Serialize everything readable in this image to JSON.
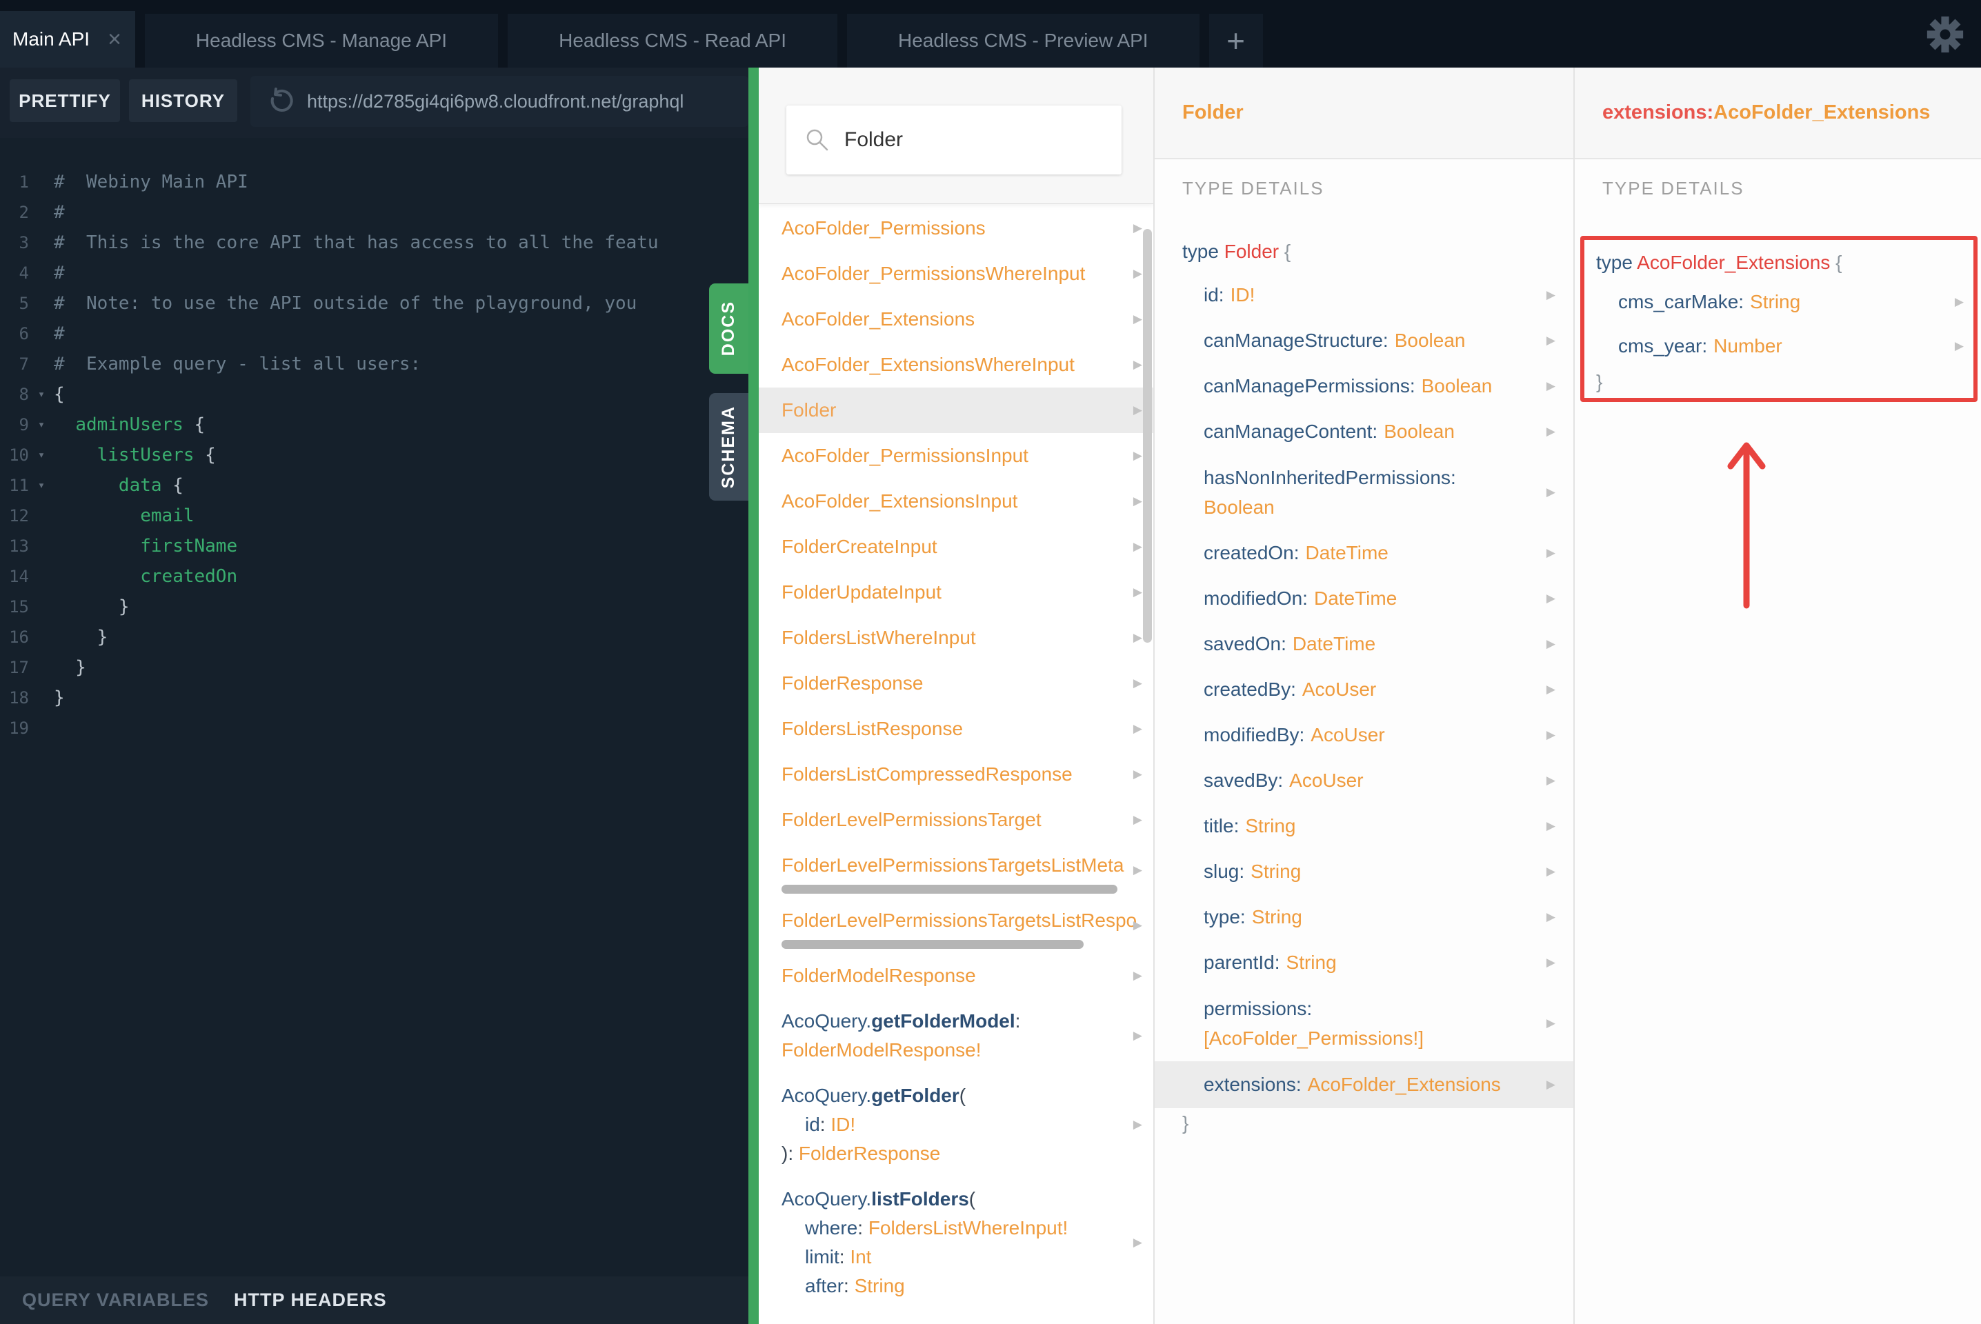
{
  "tabs": {
    "items": [
      {
        "label": "Main API",
        "active": true,
        "closable": true
      },
      {
        "label": "Headless CMS - Manage API",
        "active": false,
        "closable": false
      },
      {
        "label": "Headless CMS - Read API",
        "active": false,
        "closable": false
      },
      {
        "label": "Headless CMS - Preview API",
        "active": false,
        "closable": false
      }
    ],
    "add_label": "+"
  },
  "toolbar": {
    "prettify": "PRETTIFY",
    "history": "HISTORY",
    "url": "https://d2785gi4qi6pw8.cloudfront.net/graphql"
  },
  "editor": {
    "lines": [
      {
        "n": 1,
        "fold": false,
        "parts": [
          {
            "t": "#  Webiny Main API",
            "c": "com"
          }
        ]
      },
      {
        "n": 2,
        "fold": false,
        "parts": [
          {
            "t": "#",
            "c": "com"
          }
        ]
      },
      {
        "n": 3,
        "fold": false,
        "parts": [
          {
            "t": "#  This is the core API that has access to all the featu",
            "c": "com"
          }
        ]
      },
      {
        "n": 4,
        "fold": false,
        "parts": [
          {
            "t": "#",
            "c": "com"
          }
        ]
      },
      {
        "n": 5,
        "fold": false,
        "parts": [
          {
            "t": "#  Note: to use the API outside of the playground, you",
            "c": "com"
          }
        ]
      },
      {
        "n": 6,
        "fold": false,
        "parts": [
          {
            "t": "#",
            "c": "com"
          }
        ]
      },
      {
        "n": 7,
        "fold": false,
        "parts": [
          {
            "t": "#  Example query - list all users:",
            "c": "com"
          }
        ]
      },
      {
        "n": 8,
        "fold": true,
        "parts": [
          {
            "t": "{",
            "c": "pun"
          }
        ]
      },
      {
        "n": 9,
        "fold": true,
        "parts": [
          {
            "t": "  ",
            "c": "pun"
          },
          {
            "t": "adminUsers",
            "c": "fld"
          },
          {
            "t": " {",
            "c": "pun"
          }
        ]
      },
      {
        "n": 10,
        "fold": true,
        "parts": [
          {
            "t": "    ",
            "c": "pun"
          },
          {
            "t": "listUsers",
            "c": "fld"
          },
          {
            "t": " {",
            "c": "pun"
          }
        ]
      },
      {
        "n": 11,
        "fold": true,
        "parts": [
          {
            "t": "      ",
            "c": "pun"
          },
          {
            "t": "data",
            "c": "fld"
          },
          {
            "t": " {",
            "c": "pun"
          }
        ]
      },
      {
        "n": 12,
        "fold": false,
        "parts": [
          {
            "t": "        ",
            "c": "pun"
          },
          {
            "t": "email",
            "c": "fld"
          }
        ]
      },
      {
        "n": 13,
        "fold": false,
        "parts": [
          {
            "t": "        ",
            "c": "pun"
          },
          {
            "t": "firstName",
            "c": "fld"
          }
        ]
      },
      {
        "n": 14,
        "fold": false,
        "parts": [
          {
            "t": "        ",
            "c": "pun"
          },
          {
            "t": "createdOn",
            "c": "fld"
          }
        ]
      },
      {
        "n": 15,
        "fold": false,
        "parts": [
          {
            "t": "      }",
            "c": "pun"
          }
        ]
      },
      {
        "n": 16,
        "fold": false,
        "parts": [
          {
            "t": "    }",
            "c": "pun"
          }
        ]
      },
      {
        "n": 17,
        "fold": false,
        "parts": [
          {
            "t": "  }",
            "c": "pun"
          }
        ]
      },
      {
        "n": 18,
        "fold": false,
        "parts": [
          {
            "t": "}",
            "c": "pun"
          }
        ]
      },
      {
        "n": 19,
        "fold": false,
        "parts": []
      }
    ],
    "footer": {
      "query_variables": "QUERY VARIABLES",
      "http_headers": "HTTP HEADERS"
    }
  },
  "side_tabs": {
    "docs": "DOCS",
    "schema": "SCHEMA"
  },
  "docs_panel": {
    "search_value": "Folder",
    "items": [
      {
        "kind": "type",
        "label": "AcoFolder_Permissions"
      },
      {
        "kind": "type",
        "label": "AcoFolder_PermissionsWhereInput"
      },
      {
        "kind": "type",
        "label": "AcoFolder_Extensions"
      },
      {
        "kind": "type",
        "label": "AcoFolder_ExtensionsWhereInput"
      },
      {
        "kind": "type",
        "label": "Folder",
        "selected": true
      },
      {
        "kind": "type",
        "label": "AcoFolder_PermissionsInput"
      },
      {
        "kind": "type",
        "label": "AcoFolder_ExtensionsInput"
      },
      {
        "kind": "type",
        "label": "FolderCreateInput"
      },
      {
        "kind": "type",
        "label": "FolderUpdateInput"
      },
      {
        "kind": "type",
        "label": "FoldersListWhereInput"
      },
      {
        "kind": "type",
        "label": "FolderResponse"
      },
      {
        "kind": "type",
        "label": "FoldersListResponse"
      },
      {
        "kind": "type",
        "label": "FoldersListCompressedResponse"
      },
      {
        "kind": "type",
        "label": "FolderLevelPermissionsTarget"
      },
      {
        "kind": "type",
        "label": "FolderLevelPermissionsTargetsListMeta",
        "hscroll": 487
      },
      {
        "kind": "type",
        "label": "FolderLevelPermissionsTargetsListRespo",
        "hscroll": 438
      },
      {
        "kind": "type",
        "label": "FolderModelResponse"
      },
      {
        "kind": "query",
        "lines": [
          {
            "ind": false,
            "parts": [
              {
                "t": "AcoQuery.",
                "c": "bl"
              },
              {
                "t": "getFolderModel",
                "c": "bb"
              },
              {
                "t": ":",
                "c": "dk"
              }
            ]
          },
          {
            "ind": false,
            "parts": [
              {
                "t": "FolderModelResponse!",
                "c": "or"
              }
            ]
          }
        ]
      },
      {
        "kind": "query",
        "lines": [
          {
            "ind": false,
            "parts": [
              {
                "t": "AcoQuery.",
                "c": "bl"
              },
              {
                "t": "getFolder",
                "c": "bb"
              },
              {
                "t": "(",
                "c": "dk"
              }
            ]
          },
          {
            "ind": true,
            "parts": [
              {
                "t": "id",
                "c": "bl"
              },
              {
                "t": ": ",
                "c": "dk"
              },
              {
                "t": "ID!",
                "c": "or"
              }
            ]
          },
          {
            "ind": false,
            "parts": [
              {
                "t": "): ",
                "c": "dk"
              },
              {
                "t": "FolderResponse",
                "c": "or"
              }
            ]
          }
        ]
      },
      {
        "kind": "query",
        "lines": [
          {
            "ind": false,
            "parts": [
              {
                "t": "AcoQuery.",
                "c": "bl"
              },
              {
                "t": "listFolders",
                "c": "bb"
              },
              {
                "t": "(",
                "c": "dk"
              }
            ]
          },
          {
            "ind": true,
            "parts": [
              {
                "t": "where",
                "c": "bl"
              },
              {
                "t": ": ",
                "c": "dk"
              },
              {
                "t": "FoldersListWhereInput!",
                "c": "or"
              }
            ]
          },
          {
            "ind": true,
            "parts": [
              {
                "t": "limit",
                "c": "bl"
              },
              {
                "t": ": ",
                "c": "dk"
              },
              {
                "t": "Int",
                "c": "or"
              }
            ]
          },
          {
            "ind": true,
            "parts": [
              {
                "t": "after",
                "c": "bl"
              },
              {
                "t": ": ",
                "c": "dk"
              },
              {
                "t": "String",
                "c": "or"
              }
            ]
          }
        ]
      }
    ]
  },
  "type_panel": {
    "title": "Folder",
    "section": "TYPE DETAILS",
    "decl_keyword": "type",
    "decl_name": "Folder",
    "open_brace": "{",
    "close_brace": "}",
    "fields": [
      {
        "name": "id",
        "type": "ID!"
      },
      {
        "name": "canManageStructure",
        "type": "Boolean"
      },
      {
        "name": "canManagePermissions",
        "type": "Boolean"
      },
      {
        "name": "canManageContent",
        "type": "Boolean"
      },
      {
        "name": "hasNonInheritedPermissions",
        "type": "Boolean",
        "wrap": true
      },
      {
        "name": "createdOn",
        "type": "DateTime"
      },
      {
        "name": "modifiedOn",
        "type": "DateTime"
      },
      {
        "name": "savedOn",
        "type": "DateTime"
      },
      {
        "name": "createdBy",
        "type": "AcoUser"
      },
      {
        "name": "modifiedBy",
        "type": "AcoUser"
      },
      {
        "name": "savedBy",
        "type": "AcoUser"
      },
      {
        "name": "title",
        "type": "String"
      },
      {
        "name": "slug",
        "type": "String"
      },
      {
        "name": "type",
        "type": "String"
      },
      {
        "name": "parentId",
        "type": "String"
      },
      {
        "name": "permissions",
        "type": "[AcoFolder_Permissions!]",
        "wrap": true
      },
      {
        "name": "extensions",
        "type": "AcoFolder_Extensions",
        "highlight": true
      }
    ]
  },
  "extensions_panel": {
    "header_field": "extensions:",
    "header_type": "AcoFolder_Extensions",
    "section": "TYPE DETAILS",
    "decl_keyword": "type",
    "decl_name": "AcoFolder_Extensions",
    "open_brace": "{",
    "close_brace": "}",
    "fields": [
      {
        "name": "cms_carMake",
        "type": "String"
      },
      {
        "name": "cms_year",
        "type": "Number"
      }
    ]
  },
  "colors": {
    "accent_green": "#3fa55e",
    "docs_orange": "#ef9b3d",
    "field_blue": "#33587e",
    "type_red": "#e2433d",
    "annotation_red": "#e8433e",
    "selected_row_bg": "#ebebeb",
    "dark_bg": "#0c141e",
    "editor_bg": "#15202b",
    "code_green": "#3aad6f"
  }
}
